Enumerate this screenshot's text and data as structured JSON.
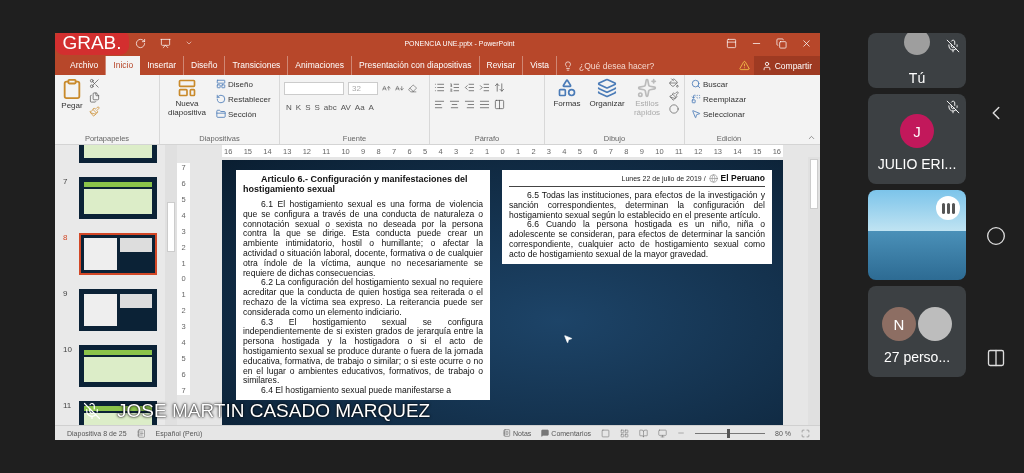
{
  "recording_badge": "GRAB.",
  "window": {
    "title": "PONENCIA UNE.pptx - PowerPoint"
  },
  "tabs": [
    {
      "label": "Archivo",
      "selected": false
    },
    {
      "label": "Inicio",
      "selected": true
    },
    {
      "label": "Insertar",
      "selected": false
    },
    {
      "label": "Diseño",
      "selected": false
    },
    {
      "label": "Transiciones",
      "selected": false
    },
    {
      "label": "Animaciones",
      "selected": false
    },
    {
      "label": "Presentación con diapositivas",
      "selected": false
    },
    {
      "label": "Revisar",
      "selected": false
    },
    {
      "label": "Vista",
      "selected": false
    }
  ],
  "tell_me": {
    "placeholder": "¿Qué desea hacer?"
  },
  "share_button": "Compartir",
  "ribbon": {
    "clipboard": {
      "label": "Portapapeles",
      "paste": "Pegar"
    },
    "slides": {
      "label": "Diapositivas",
      "new_slide": "Nueva diapositiva",
      "commands": [
        "Diseño",
        "Restablecer",
        "Sección"
      ]
    },
    "font": {
      "label": "Fuente",
      "font_size": "32",
      "format_buttons": [
        "N",
        "K",
        "S",
        "S",
        "abc",
        "AV",
        "Aa",
        "A"
      ]
    },
    "paragraph": {
      "label": "Párrafo"
    },
    "drawing": {
      "label": "Dibujo",
      "commands": [
        {
          "label": "Formas",
          "disabled": false
        },
        {
          "label": "Organizar",
          "disabled": false
        },
        {
          "label": "Estilos rápidos",
          "disabled": true
        }
      ]
    },
    "editing": {
      "label": "Edición",
      "commands": [
        "Buscar",
        "Reemplazar",
        "Seleccionar"
      ]
    }
  },
  "thumbnails": [
    {
      "kind": "table",
      "selected": false
    },
    {
      "number": "7",
      "kind": "table",
      "selected": false
    },
    {
      "number": "8",
      "kind": "document",
      "selected": true
    },
    {
      "number": "9",
      "kind": "document",
      "selected": false
    },
    {
      "number": "10",
      "kind": "table",
      "selected": false
    },
    {
      "number": "11",
      "kind": "table",
      "selected": false
    }
  ],
  "horizontal_ruler": [
    "16",
    "15",
    "14",
    "13",
    "12",
    "11",
    "10",
    "9",
    "8",
    "7",
    "6",
    "5",
    "4",
    "3",
    "2",
    "1",
    "0",
    "1",
    "2",
    "3",
    "4",
    "5",
    "6",
    "7",
    "8",
    "9",
    "10",
    "11",
    "12",
    "13",
    "14",
    "15",
    "16"
  ],
  "vertical_ruler": [
    "7",
    "6",
    "5",
    "4",
    "3",
    "2",
    "1",
    "0",
    "1",
    "2",
    "3",
    "4",
    "5",
    "6",
    "7"
  ],
  "slide": {
    "left": {
      "heading": "Articulo 6.- Configuración y manifestaciones del hostigamiento sexual",
      "paragraphs": [
        "6.1 El hostigamiento sexual es una forma de violencia que se configura a través de una conducta de naturaleza o connotación sexual o sexista no deseada por la persona contra la que se dirige. Esta conducta puede crear un ambiente intimidatorio, hostil o humillante; o afectar la actividad o situación laboral, docente, formativa o de cualquier otra índole de la víctima, aunque no necesariamente se requiere de dichas consecuencias.",
        "6.2 La configuración del hostigamiento sexual no requiere acreditar que la conducta de quien hostiga sea reiterada o el rechazo de la víctima sea expreso. La reiterancia puede ser considerada como un elemento indiciario.",
        "6.3 El hostigamiento sexual se configura independientemente de si existen grados de jerarquía entre la persona hostigada y la hostigadora o si el acto de hostigamiento sexual se produce durante o fuera de la jornada educativa, formativa, de trabajo o similar; o si este ocurre o no en el lugar o ambientes educativos, formativos, de trabajo o similares.",
        "6.4 El hostigamiento sexual puede manifestarse a"
      ]
    },
    "right": {
      "date": "Lunes 22 de julio de 2019 /",
      "newspaper": "El Peruano",
      "paragraphs": [
        "6.5 Todas las instituciones, para efectos de la investigación y sanción correspondientes, determinan la configuración del hostigamiento sexual según lo establecido en el presente artículo.",
        "6.6 Cuando la persona hostigada es un niño, niña o adolescente se consideran, para efectos de determinar la sanción correspondiente, cualquier acto de hostigamiento sexual como acto de hostigamiento sexual de la mayor gravedad."
      ]
    }
  },
  "status_bar": {
    "slide_count": "Diapositiva 8 de 25",
    "language": "Español (Perú)",
    "notes": "Notas",
    "comments": "Comentarios",
    "zoom": "80 %",
    "zoom_slider": {
      "level": 0.45
    }
  },
  "presenter": {
    "name": "JOSE MARTIN CASADO MARQUEZ",
    "muted": true
  },
  "participants": [
    {
      "kind": "self",
      "name": "Tú",
      "muted": true
    },
    {
      "kind": "initial",
      "initial": "J",
      "color": "#c2185b",
      "name": "JULIO ERI...",
      "muted": true
    },
    {
      "kind": "video",
      "speaking": true
    },
    {
      "kind": "group",
      "initial": "N",
      "color": "#8d6e63",
      "name": "27 perso..."
    }
  ]
}
